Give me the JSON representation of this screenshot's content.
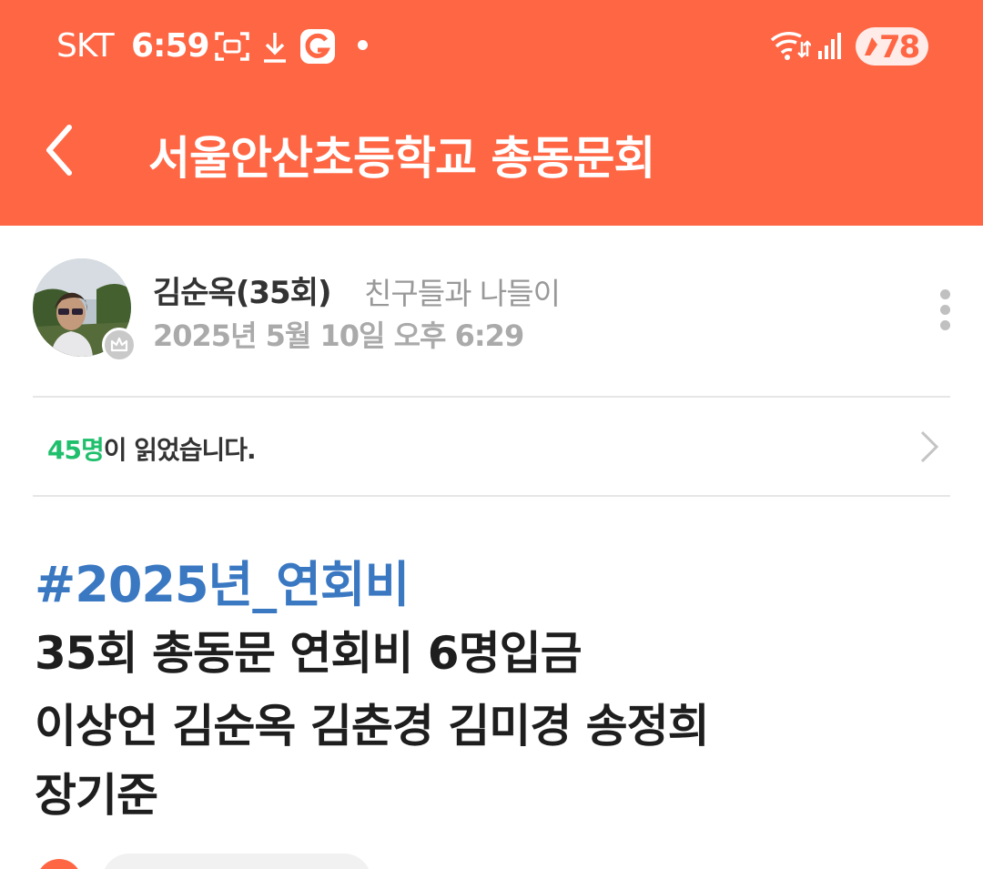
{
  "status_bar": {
    "carrier": "SKT",
    "time": "6:59",
    "battery": "78",
    "icons": [
      "screenshot-icon",
      "download-icon",
      "g-app-icon",
      "notification-dot",
      "wifi-icon",
      "signal-icon",
      "battery-icon"
    ]
  },
  "header": {
    "title": "서울안산초등학교 총동문회",
    "back_icon": "chevron-left-icon",
    "background_color": "#ff6644"
  },
  "post": {
    "author": "김순옥(35회)",
    "category": "친구들과 나들이",
    "date": "2025년 5월 10일 오후 6:29",
    "readers_count": "45명",
    "readers_suffix": "이 읽었습니다.",
    "hashtag": "#2025년_연회비",
    "body_lines": [
      "35회 총동문 연회비 6명입금",
      "이상언 김순옥 김춘경 김미경 송정희",
      "장기준"
    ]
  },
  "colors": {
    "accent": "#ff6644",
    "hashtag": "#3a78c2",
    "readers_count": "#1fbf6c"
  }
}
